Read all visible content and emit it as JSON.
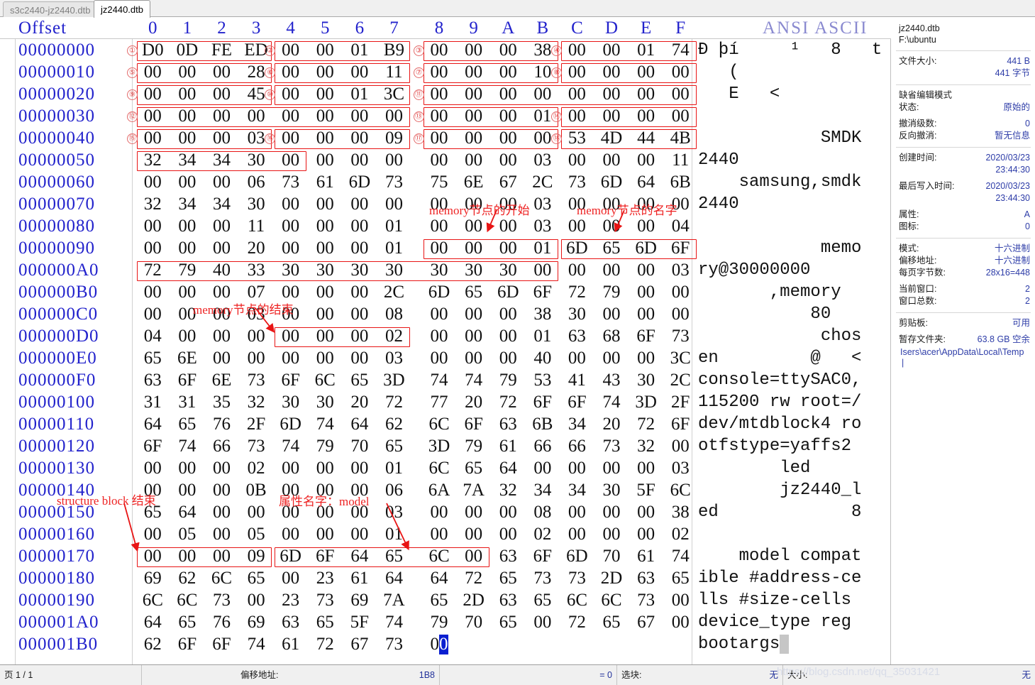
{
  "tabs": [
    {
      "label": "s3c2440-jz2440.dtb",
      "active": false
    },
    {
      "label": "jz2440.dtb",
      "active": true
    }
  ],
  "header": {
    "offset_label": "Offset",
    "columns": [
      "0",
      "1",
      "2",
      "3",
      "4",
      "5",
      "6",
      "7",
      "8",
      "9",
      "A",
      "B",
      "C",
      "D",
      "E",
      "F"
    ],
    "ansi_label": "ANSI ASCII"
  },
  "rows": [
    {
      "offset": "00000000",
      "bytes": [
        "D0",
        "0D",
        "FE",
        "ED",
        "00",
        "00",
        "01",
        "B9",
        "00",
        "00",
        "00",
        "38",
        "00",
        "00",
        "01",
        "74"
      ],
      "ascii": "Ð þí     ¹   8   t"
    },
    {
      "offset": "00000010",
      "bytes": [
        "00",
        "00",
        "00",
        "28",
        "00",
        "00",
        "00",
        "11",
        "00",
        "00",
        "00",
        "10",
        "00",
        "00",
        "00",
        "00"
      ],
      "ascii": "   (            "
    },
    {
      "offset": "00000020",
      "bytes": [
        "00",
        "00",
        "00",
        "45",
        "00",
        "00",
        "01",
        "3C",
        "00",
        "00",
        "00",
        "00",
        "00",
        "00",
        "00",
        "00"
      ],
      "ascii": "   E   <        "
    },
    {
      "offset": "00000030",
      "bytes": [
        "00",
        "00",
        "00",
        "00",
        "00",
        "00",
        "00",
        "00",
        "00",
        "00",
        "00",
        "01",
        "00",
        "00",
        "00",
        "00"
      ],
      "ascii": "                "
    },
    {
      "offset": "00000040",
      "bytes": [
        "00",
        "00",
        "00",
        "03",
        "00",
        "00",
        "00",
        "09",
        "00",
        "00",
        "00",
        "00",
        "53",
        "4D",
        "44",
        "4B"
      ],
      "ascii": "            SMDK"
    },
    {
      "offset": "00000050",
      "bytes": [
        "32",
        "34",
        "34",
        "30",
        "00",
        "00",
        "00",
        "00",
        "00",
        "00",
        "00",
        "03",
        "00",
        "00",
        "00",
        "11"
      ],
      "ascii": "2440            "
    },
    {
      "offset": "00000060",
      "bytes": [
        "00",
        "00",
        "00",
        "06",
        "73",
        "61",
        "6D",
        "73",
        "75",
        "6E",
        "67",
        "2C",
        "73",
        "6D",
        "64",
        "6B"
      ],
      "ascii": "    samsung,smdk"
    },
    {
      "offset": "00000070",
      "bytes": [
        "32",
        "34",
        "34",
        "30",
        "00",
        "00",
        "00",
        "00",
        "00",
        "00",
        "00",
        "03",
        "00",
        "00",
        "00",
        "00"
      ],
      "ascii": "2440            "
    },
    {
      "offset": "00000080",
      "bytes": [
        "00",
        "00",
        "00",
        "11",
        "00",
        "00",
        "00",
        "01",
        "00",
        "00",
        "00",
        "03",
        "00",
        "00",
        "00",
        "04"
      ],
      "ascii": "                "
    },
    {
      "offset": "00000090",
      "bytes": [
        "00",
        "00",
        "00",
        "20",
        "00",
        "00",
        "00",
        "01",
        "00",
        "00",
        "00",
        "01",
        "6D",
        "65",
        "6D",
        "6F"
      ],
      "ascii": "            memo"
    },
    {
      "offset": "000000A0",
      "bytes": [
        "72",
        "79",
        "40",
        "33",
        "30",
        "30",
        "30",
        "30",
        "30",
        "30",
        "30",
        "00",
        "00",
        "00",
        "00",
        "03"
      ],
      "ascii": "ry@30000000     "
    },
    {
      "offset": "000000B0",
      "bytes": [
        "00",
        "00",
        "00",
        "07",
        "00",
        "00",
        "00",
        "2C",
        "6D",
        "65",
        "6D",
        "6F",
        "72",
        "79",
        "00",
        "00"
      ],
      "ascii": "       ,memory  "
    },
    {
      "offset": "000000C0",
      "bytes": [
        "00",
        "00",
        "00",
        "03",
        "00",
        "00",
        "00",
        "08",
        "00",
        "00",
        "00",
        "38",
        "30",
        "00",
        "00",
        "00"
      ],
      "ascii": "           80   "
    },
    {
      "offset": "000000D0",
      "bytes": [
        "04",
        "00",
        "00",
        "00",
        "00",
        "00",
        "00",
        "02",
        "00",
        "00",
        "00",
        "01",
        "63",
        "68",
        "6F",
        "73"
      ],
      "ascii": "            chos"
    },
    {
      "offset": "000000E0",
      "bytes": [
        "65",
        "6E",
        "00",
        "00",
        "00",
        "00",
        "00",
        "03",
        "00",
        "00",
        "00",
        "40",
        "00",
        "00",
        "00",
        "3C"
      ],
      "ascii": "en         @   <"
    },
    {
      "offset": "000000F0",
      "bytes": [
        "63",
        "6F",
        "6E",
        "73",
        "6F",
        "6C",
        "65",
        "3D",
        "74",
        "74",
        "79",
        "53",
        "41",
        "43",
        "30",
        "2C"
      ],
      "ascii": "console=ttySAC0,"
    },
    {
      "offset": "00000100",
      "bytes": [
        "31",
        "31",
        "35",
        "32",
        "30",
        "30",
        "20",
        "72",
        "77",
        "20",
        "72",
        "6F",
        "6F",
        "74",
        "3D",
        "2F"
      ],
      "ascii": "115200 rw root=/"
    },
    {
      "offset": "00000110",
      "bytes": [
        "64",
        "65",
        "76",
        "2F",
        "6D",
        "74",
        "64",
        "62",
        "6C",
        "6F",
        "63",
        "6B",
        "34",
        "20",
        "72",
        "6F"
      ],
      "ascii": "dev/mtdblock4 ro"
    },
    {
      "offset": "00000120",
      "bytes": [
        "6F",
        "74",
        "66",
        "73",
        "74",
        "79",
        "70",
        "65",
        "3D",
        "79",
        "61",
        "66",
        "66",
        "73",
        "32",
        "00"
      ],
      "ascii": "otfstype=yaffs2 "
    },
    {
      "offset": "00000130",
      "bytes": [
        "00",
        "00",
        "00",
        "02",
        "00",
        "00",
        "00",
        "01",
        "6C",
        "65",
        "64",
        "00",
        "00",
        "00",
        "00",
        "03"
      ],
      "ascii": "        led     "
    },
    {
      "offset": "00000140",
      "bytes": [
        "00",
        "00",
        "00",
        "0B",
        "00",
        "00",
        "00",
        "06",
        "6A",
        "7A",
        "32",
        "34",
        "34",
        "30",
        "5F",
        "6C"
      ],
      "ascii": "        jz2440_l"
    },
    {
      "offset": "00000150",
      "bytes": [
        "65",
        "64",
        "00",
        "00",
        "00",
        "00",
        "00",
        "03",
        "00",
        "00",
        "00",
        "08",
        "00",
        "00",
        "00",
        "38"
      ],
      "ascii": "ed             8"
    },
    {
      "offset": "00000160",
      "bytes": [
        "00",
        "05",
        "00",
        "05",
        "00",
        "00",
        "00",
        "01",
        "00",
        "00",
        "00",
        "02",
        "00",
        "00",
        "00",
        "02"
      ],
      "ascii": "                "
    },
    {
      "offset": "00000170",
      "bytes": [
        "00",
        "00",
        "00",
        "09",
        "6D",
        "6F",
        "64",
        "65",
        "6C",
        "00",
        "63",
        "6F",
        "6D",
        "70",
        "61",
        "74"
      ],
      "ascii": "    model compat"
    },
    {
      "offset": "00000180",
      "bytes": [
        "69",
        "62",
        "6C",
        "65",
        "00",
        "23",
        "61",
        "64",
        "64",
        "72",
        "65",
        "73",
        "73",
        "2D",
        "63",
        "65"
      ],
      "ascii": "ible #address-ce"
    },
    {
      "offset": "00000190",
      "bytes": [
        "6C",
        "6C",
        "73",
        "00",
        "23",
        "73",
        "69",
        "7A",
        "65",
        "2D",
        "63",
        "65",
        "6C",
        "6C",
        "73",
        "00"
      ],
      "ascii": "lls #size-cells "
    },
    {
      "offset": "000001A0",
      "bytes": [
        "64",
        "65",
        "76",
        "69",
        "63",
        "65",
        "5F",
        "74",
        "79",
        "70",
        "65",
        "00",
        "72",
        "65",
        "67",
        "00"
      ],
      "ascii": "device_type reg "
    },
    {
      "offset": "000001B0",
      "bytes": [
        "62",
        "6F",
        "6F",
        "74",
        "61",
        "72",
        "67",
        "73",
        "00"
      ],
      "ascii": "bootargs",
      "caret_index": 8,
      "ascii_caret": true
    }
  ],
  "annotations": {
    "circled_numbers": [
      "①",
      "②",
      "③",
      "④",
      "⑤",
      "⑥",
      "⑦",
      "⑧",
      "⑨",
      "⑩",
      "⑪",
      "⑫",
      "⑬",
      "⑭",
      "⑮",
      "⑯",
      "⑰",
      "⑱"
    ],
    "labels": [
      {
        "text": "memory节点的开始"
      },
      {
        "text": "memory节点的名字"
      },
      {
        "text": "memory节点的结束"
      },
      {
        "text": "structure block 结束"
      },
      {
        "text": "属性名字：model"
      }
    ]
  },
  "info_panel": {
    "file_name": "jz2440.dtb",
    "file_path": "F:\\ubuntu",
    "size_label": "文件大小:",
    "size_value": "441 B",
    "size_value_bytes": "441 字节",
    "edit_mode_title": "缺省编辑模式",
    "state_label": "状态:",
    "state_value": "原始的",
    "undo_levels_label": "撤消级数:",
    "undo_levels_value": "0",
    "undo_reverse_label": "反向撤消:",
    "undo_reverse_value": "暂无信息",
    "created_label": "创建时间:",
    "created_date": "2020/03/23",
    "created_time": "23:44:30",
    "modified_label": "最后写入时间:",
    "modified_date": "2020/03/23",
    "modified_time": "23:44:30",
    "attr_label": "属性:",
    "attr_value": "A",
    "icon_label": "图标:",
    "icon_value": "0",
    "mode_label": "模式:",
    "mode_value": "十六进制",
    "offset_addr_label": "偏移地址:",
    "offset_addr_value": "十六进制",
    "bytes_per_page_label": "每页字节数:",
    "bytes_per_page_value": "28x16=448",
    "current_window_label": "当前窗口:",
    "current_window_value": "2",
    "total_windows_label": "窗口总数:",
    "total_windows_value": "2",
    "clipboard_label": "剪贴板:",
    "clipboard_value": "可用",
    "temp_folder_label": "暂存文件夹:",
    "temp_folder_value": "63.8 GB 空余",
    "temp_folder_path": "Isers\\acer\\AppData\\Local\\Temp"
  },
  "statusbar": {
    "page_label": "页 1 / 1",
    "offset_label": "偏移地址:",
    "offset_value": "1B8",
    "equals_value": "= 0",
    "block_label": "选块:",
    "block_value": "无",
    "size_label": "大小:",
    "size_value": "无"
  },
  "watermark": "https://blog.csdn.net/qq_35031421",
  "colors": {
    "offset_blue": "#2222cc",
    "annotation_red": "#ee2222",
    "box_red": "#e81414",
    "info_value_blue": "#2e3da8",
    "caret_blue": "#0a1fd0"
  }
}
